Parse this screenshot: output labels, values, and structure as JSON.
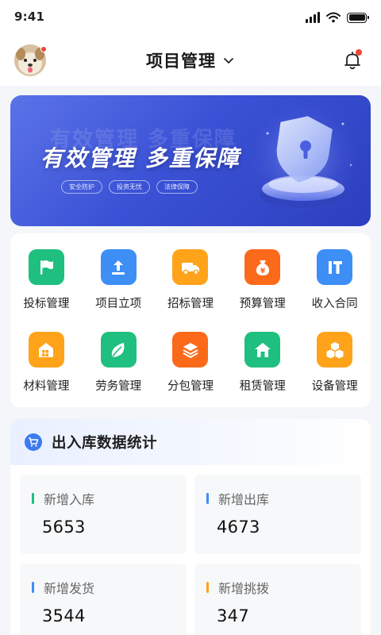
{
  "status_bar": {
    "time": "9:41"
  },
  "header": {
    "title": "项目管理"
  },
  "banner": {
    "title": "有效管理  多重保障",
    "ghost_text": "有效管理  多重保障",
    "tags": [
      "安全防护",
      "投资无忧",
      "法律保障"
    ]
  },
  "menu": {
    "items": [
      {
        "label": "投标管理",
        "icon": "flag-icon",
        "color": "#1fbf7f"
      },
      {
        "label": "项目立项",
        "icon": "upload-icon",
        "color": "#3d8ef5"
      },
      {
        "label": "招标管理",
        "icon": "truck-icon",
        "color": "#ffa31a"
      },
      {
        "label": "预算管理",
        "icon": "money-bag-icon",
        "color": "#fa6a1a"
      },
      {
        "label": "收入合同",
        "icon": "it-icon",
        "color": "#3d8ef5"
      },
      {
        "label": "材料管理",
        "icon": "house-icon",
        "color": "#ffa31a"
      },
      {
        "label": "劳务管理",
        "icon": "leaf-icon",
        "color": "#1fbf7f"
      },
      {
        "label": "分包管理",
        "icon": "layers-icon",
        "color": "#fa6a1a"
      },
      {
        "label": "租赁管理",
        "icon": "home-icon",
        "color": "#1fbf7f"
      },
      {
        "label": "设备管理",
        "icon": "boxes-icon",
        "color": "#ffa31a"
      }
    ]
  },
  "stats": {
    "title": "出入库数据统计",
    "items": [
      {
        "label": "新增入库",
        "value": "5653",
        "color": "#1fbf7f"
      },
      {
        "label": "新增出库",
        "value": "4673",
        "color": "#3d8ef5"
      },
      {
        "label": "新增发货",
        "value": "3544",
        "color": "#3d8ef5"
      },
      {
        "label": "新增挑拨",
        "value": "347",
        "color": "#ffa31a"
      }
    ]
  }
}
